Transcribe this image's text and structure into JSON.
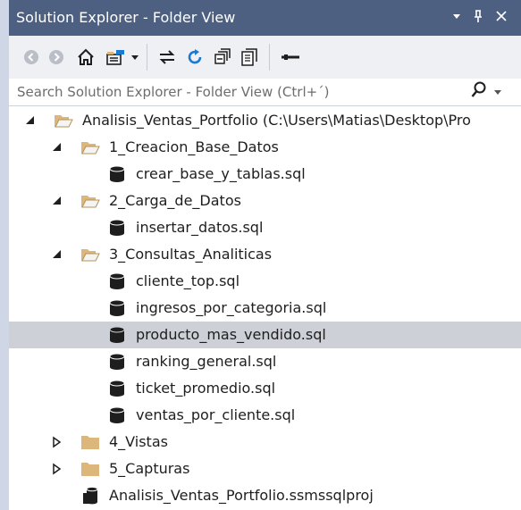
{
  "window": {
    "title": "Solution Explorer - Folder View",
    "controls": {
      "dropdown": "▾",
      "pin": "ᵖ",
      "close": "✕"
    }
  },
  "toolbar": {
    "icons": [
      "back-icon",
      "forward-icon",
      "home-icon",
      "switch-views-icon",
      "dropdown-icon",
      "sync-icon",
      "refresh-icon",
      "collapse-all-icon",
      "show-all-files-icon",
      "properties-icon"
    ]
  },
  "search": {
    "placeholder": "Search Solution Explorer - Folder View (Ctrl+´)",
    "value": ""
  },
  "tree": {
    "root": {
      "label": "Analisis_Ventas_Portfolio (C:\\Users\\Matias\\Desktop\\Pro"
    },
    "folder1": {
      "label": "1_Creacion_Base_Datos",
      "files": [
        "crear_base_y_tablas.sql"
      ]
    },
    "folder2": {
      "label": "2_Carga_de_Datos",
      "files": [
        "insertar_datos.sql"
      ]
    },
    "folder3": {
      "label": "3_Consultas_Analiticas",
      "files": [
        "cliente_top.sql",
        "ingresos_por_categoria.sql",
        "producto_mas_vendido.sql",
        "ranking_general.sql",
        "ticket_promedio.sql",
        "ventas_por_cliente.sql"
      ],
      "selected": "producto_mas_vendido.sql"
    },
    "folder4": {
      "label": "4_Vistas"
    },
    "folder5": {
      "label": "5_Capturas"
    },
    "project": {
      "label": "Analisis_Ventas_Portfolio.ssmssqlproj"
    }
  },
  "colors": {
    "titlebar": "#4d6082",
    "toolbar": "#eef0f4",
    "selection": "#cdd0d7",
    "folder": "#dcb67a",
    "db": "#1e1e1e",
    "accent": "#1c7bd1"
  }
}
